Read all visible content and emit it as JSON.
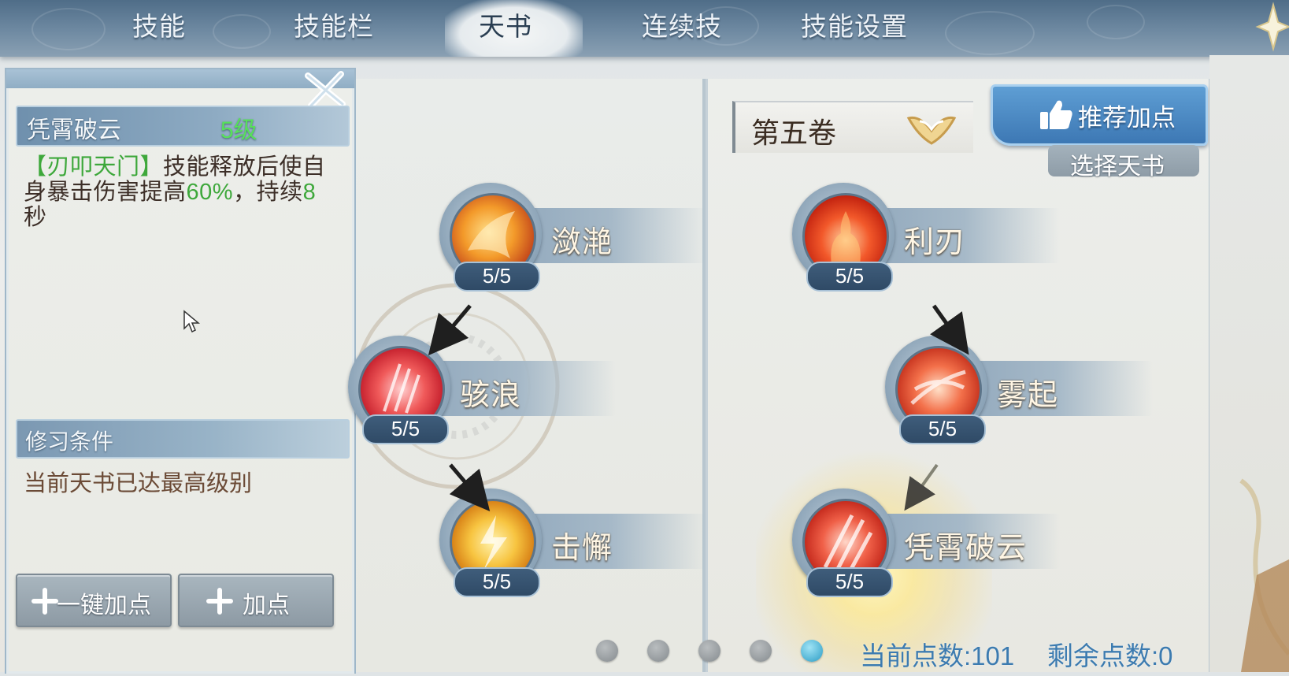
{
  "tabs": [
    {
      "label": "技能",
      "active": false
    },
    {
      "label": "技能栏",
      "active": false
    },
    {
      "label": "天书",
      "active": true
    },
    {
      "label": "连续技",
      "active": false
    },
    {
      "label": "技能设置",
      "active": false
    }
  ],
  "detail": {
    "skill_name": "凭霄破云",
    "level": "5级",
    "desc_tag": "【刃叩天门】",
    "desc_part1": "技能释放后使自身暴击伤害提高",
    "desc_pct": "60%",
    "desc_part2": "，持续",
    "desc_secs": "8",
    "desc_part3": "秒",
    "condition_title": "修习条件",
    "condition_text": "当前天书已达最高级别"
  },
  "buttons": {
    "one_click_add": "一键加点",
    "add_point": "加点",
    "recommend": "推荐加点",
    "select_book": "选择天书"
  },
  "volume": "第五卷",
  "tree_left": [
    {
      "name": "潋滟",
      "count": "5/5"
    },
    {
      "name": "骇浪",
      "count": "5/5"
    },
    {
      "name": "击懈",
      "count": "5/5"
    }
  ],
  "tree_right": [
    {
      "name": "利刃",
      "count": "5/5"
    },
    {
      "name": "雾起",
      "count": "5/5"
    },
    {
      "name": "凭霄破云",
      "count": "5/5"
    }
  ],
  "pages": {
    "total": 5,
    "current": 5
  },
  "points": {
    "current_label": "当前点数:",
    "current_value": "101",
    "remaining_label": "剩余点数:",
    "remaining_value": "0"
  },
  "colors": {
    "accent_green": "#57e05a",
    "points_blue": "#3c7bb0",
    "recommend_blue": "#4a8cc8"
  },
  "icons": [
    "close-icon",
    "plus-icon",
    "thumbs-up-icon",
    "chevron-down-icon",
    "cursor-icon"
  ]
}
